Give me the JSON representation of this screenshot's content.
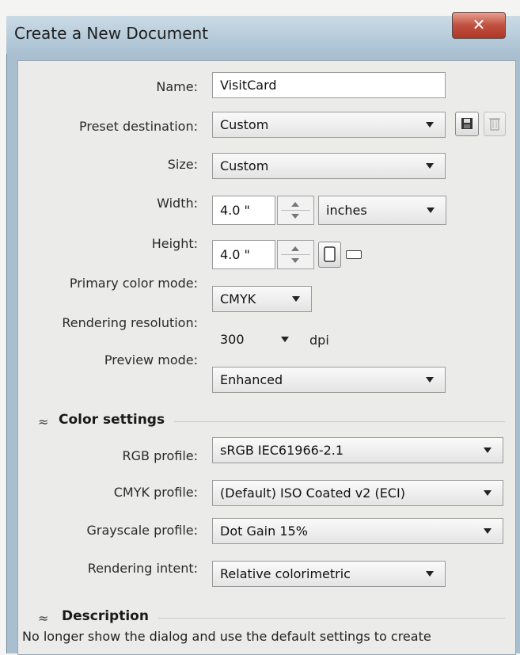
{
  "window": {
    "title": "Create a New Document",
    "close_label": "✕"
  },
  "form": {
    "name": {
      "label": "Name:",
      "value": "VisitCard"
    },
    "preset": {
      "label": "Preset destination:",
      "value": "Custom"
    },
    "size": {
      "label": "Size:",
      "value": "Custom"
    },
    "width": {
      "label": "Width:",
      "value": "4.0 \"",
      "unit": "inches"
    },
    "height": {
      "label": "Height:",
      "value": "4.0 \""
    },
    "primary_color_mode": {
      "label": "Primary color mode:",
      "value": "CMYK"
    },
    "rendering_resolution": {
      "label": "Rendering resolution:",
      "value": "300",
      "unit": "dpi"
    },
    "preview_mode": {
      "label": "Preview mode:",
      "value": "Enhanced"
    }
  },
  "color_settings": {
    "title": "Color settings",
    "rgb_profile": {
      "label": "RGB profile:",
      "value": "sRGB IEC61966-2.1"
    },
    "cmyk_profile": {
      "label": "CMYK profile:",
      "value": "(Default) ISO Coated v2 (ECI)"
    },
    "grayscale_profile": {
      "label": "Grayscale profile:",
      "value": "Dot Gain 15%"
    },
    "rendering_intent": {
      "label": "Rendering intent:",
      "value": "Relative colorimetric"
    }
  },
  "description": {
    "title": "Description",
    "text": "No longer show the dialog and use the default settings to create"
  },
  "icons": {
    "save": "save-preset-icon",
    "delete": "delete-preset-icon",
    "portrait": "portrait-icon",
    "landscape": "landscape-icon",
    "collapse": "collapse-chevron-icon"
  }
}
